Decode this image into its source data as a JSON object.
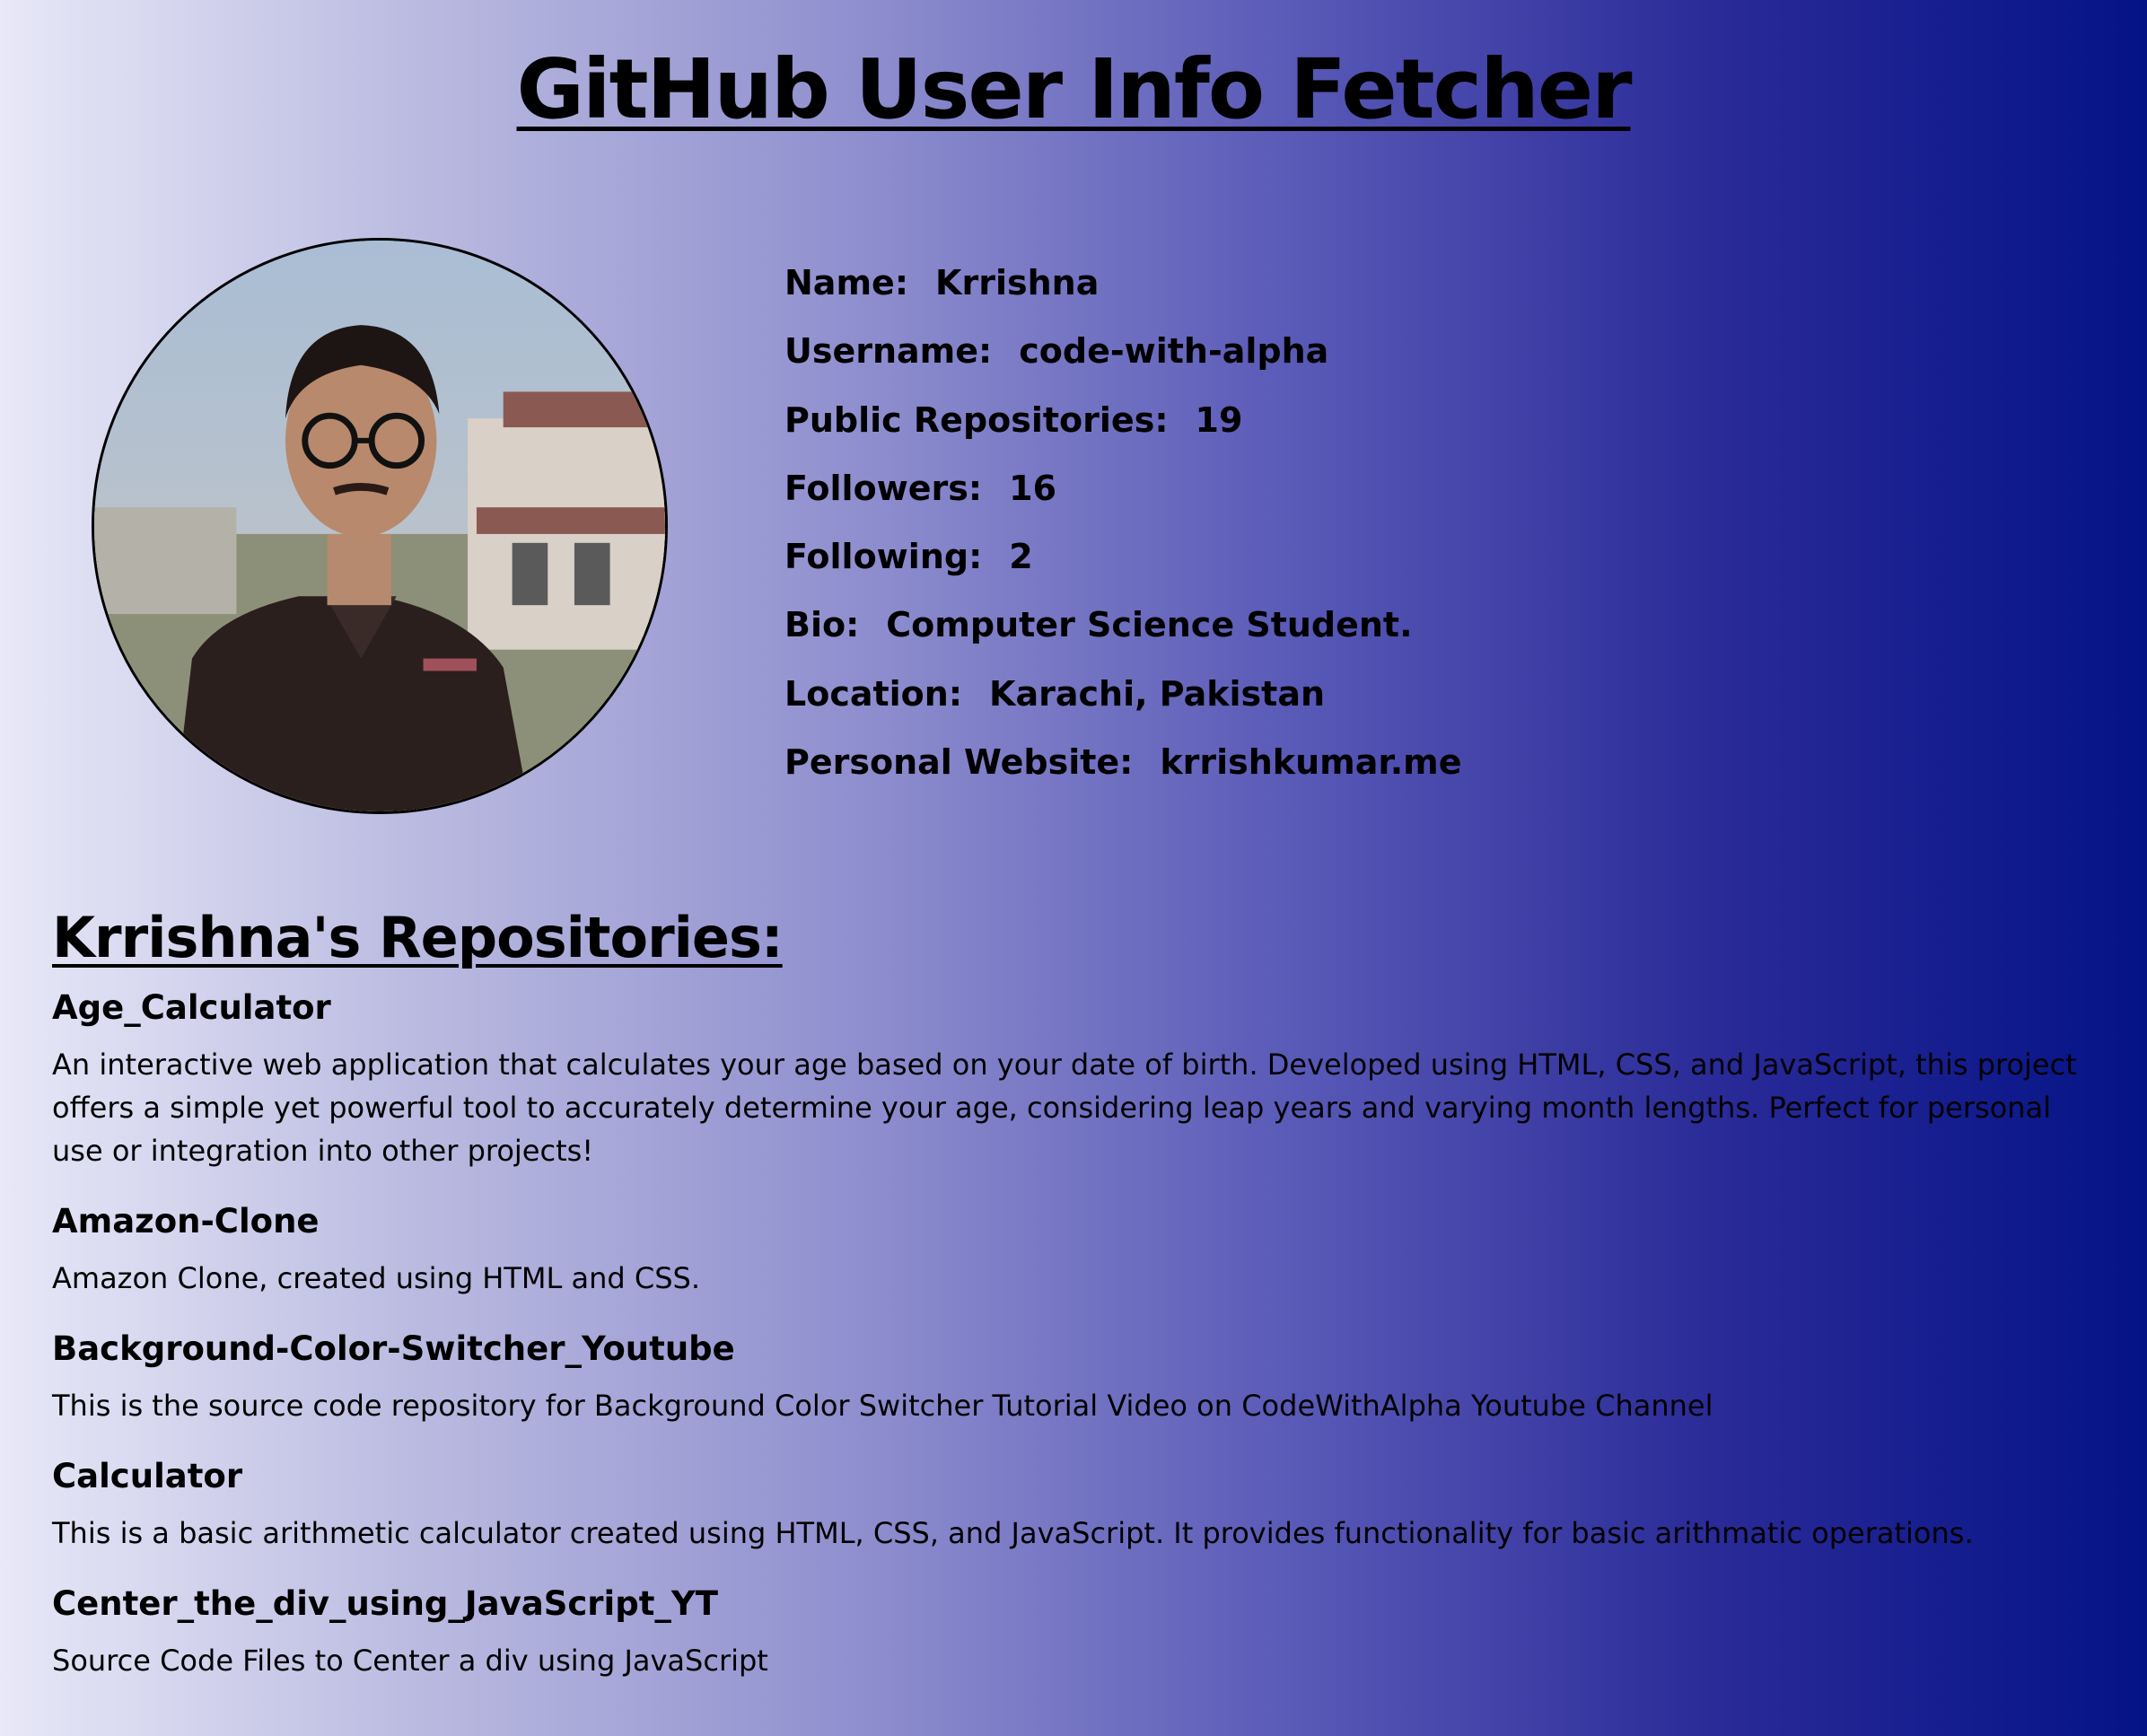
{
  "title": "GitHub User Info Fetcher",
  "profile": {
    "avatar_alt": "avatar",
    "fields": [
      {
        "label": "Name:",
        "value": "Krrishna"
      },
      {
        "label": "Username:",
        "value": "code-with-alpha"
      },
      {
        "label": "Public Repositories:",
        "value": "19"
      },
      {
        "label": "Followers:",
        "value": "16"
      },
      {
        "label": "Following:",
        "value": "2"
      },
      {
        "label": "Bio:",
        "value": "Computer Science Student."
      },
      {
        "label": "Location:",
        "value": "Karachi, Pakistan"
      },
      {
        "label": "Personal Website:",
        "value": "krrishkumar.me"
      }
    ]
  },
  "repos_section": {
    "owner": "Krrishna",
    "suffix": "'s Repositories:",
    "items": [
      {
        "name": "Age_Calculator",
        "description": "An interactive web application that calculates your age based on your date of birth. Developed using HTML, CSS, and JavaScript, this project offers a simple yet powerful tool to accurately determine your age, considering leap years and varying month lengths. Perfect for personal use or integration into other projects!"
      },
      {
        "name": "Amazon-Clone",
        "description": "Amazon Clone, created using HTML and CSS."
      },
      {
        "name": "Background-Color-Switcher_Youtube",
        "description": "This is the source code repository for Background Color Switcher Tutorial Video on CodeWithAlpha Youtube Channel"
      },
      {
        "name": "Calculator",
        "description": "This is a basic arithmetic calculator created using HTML, CSS, and JavaScript. It provides functionality for basic arithmatic operations."
      },
      {
        "name": "Center_the_div_using_JavaScript_YT",
        "description": "Source Code Files to Center a div using JavaScript"
      }
    ]
  }
}
